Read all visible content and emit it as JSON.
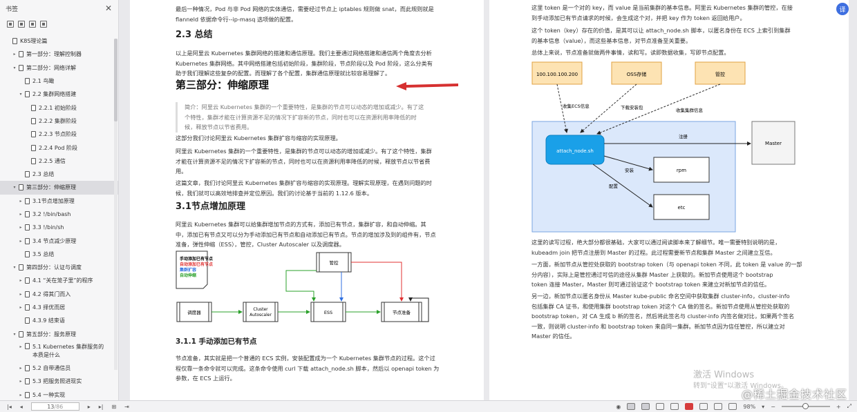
{
  "sidebar": {
    "title": "书签",
    "items": [
      {
        "label": "K8S理论篇",
        "level": 0,
        "arrow": ""
      },
      {
        "label": "第一部分：理解控制器",
        "level": 1,
        "arrow": "▸"
      },
      {
        "label": "第二部分：网络详解",
        "level": 1,
        "arrow": "▾"
      },
      {
        "label": "2.1 鸟瞰",
        "level": 2,
        "arrow": ""
      },
      {
        "label": "2.2 集群网络搭建",
        "level": 2,
        "arrow": "▾"
      },
      {
        "label": "2.2.1 初始阶段",
        "level": 3,
        "arrow": ""
      },
      {
        "label": "2.2.2 集群阶段",
        "level": 3,
        "arrow": ""
      },
      {
        "label": "2.2.3 节点阶段",
        "level": 3,
        "arrow": ""
      },
      {
        "label": "2.2.4 Pod 阶段",
        "level": 3,
        "arrow": ""
      },
      {
        "label": "2.2.5 通信",
        "level": 3,
        "arrow": ""
      },
      {
        "label": "2.3 总结",
        "level": 2,
        "arrow": ""
      },
      {
        "label": "第三部分：伸缩原理",
        "level": 1,
        "arrow": "▾",
        "selected": true
      },
      {
        "label": "3.1节点增加原理",
        "level": 2,
        "arrow": "▸"
      },
      {
        "label": "3.2 !/bin/bash",
        "level": 2,
        "arrow": "▸"
      },
      {
        "label": "3.3 !/bin/sh",
        "level": 2,
        "arrow": "▸"
      },
      {
        "label": "3.4 节点减少原理",
        "level": 2,
        "arrow": "▸"
      },
      {
        "label": "3.5 总结",
        "level": 2,
        "arrow": ""
      },
      {
        "label": "第四部分：认证与调度",
        "level": 1,
        "arrow": "▾"
      },
      {
        "label": "4.1 “关在笼子里”的程序",
        "level": 2,
        "arrow": "▸"
      },
      {
        "label": "4.2 得其门而入",
        "level": 2,
        "arrow": "▸"
      },
      {
        "label": "4.3 择优而居",
        "level": 2,
        "arrow": "▸"
      },
      {
        "label": "4.3.9 结束语",
        "level": 2,
        "arrow": ""
      },
      {
        "label": "第五部分：服务原理",
        "level": 1,
        "arrow": "▾"
      },
      {
        "label": "5.1 Kubernetes 集群服务的本质是什么",
        "level": 2,
        "arrow": "▸",
        "wrap": true
      },
      {
        "label": "5.2 自带通信员",
        "level": 2,
        "arrow": "▸"
      },
      {
        "label": "5.3 把服务照进现实",
        "level": 2,
        "arrow": "▸"
      },
      {
        "label": "5.4 一种实现",
        "level": 2,
        "arrow": "▸"
      }
    ]
  },
  "left_page": {
    "p_top": [
      "最后一种情况，Pod 与非 Pod 网络的实体通信，需要经过节点上 iptables 规则做 snat，而此规则就是",
      "flanneld 依据命令行--ip-masq 选项做的配置。"
    ],
    "h2_summary": "2.3 总结",
    "p_summary": [
      "以上是阿里云 Kubernetes 集群网络的搭建和通信原理。我们主要通过网络搭建和通信两个角度去分析",
      "Kubernetes 集群网络。其中网络搭建包括初始阶段，集群阶段，节点阶段以及 Pod 阶段，这么分类有",
      "助于我们理解这些复杂的配置。而理解了各个配置，集群通信原理就比较容易理解了。"
    ],
    "h1_part3": "第三部分：伸缩原理",
    "quote": [
      "简介：阿里云 Kubernetes 集群的一个重要特性，是集群的节点可以动态的增加或减少。有了这",
      "个特性，集群才能在计算资源不足的情况下扩容新的节点，同时也可以在资源利用率降低的时",
      "候，释放节点以节省费用。"
    ],
    "p_discuss": "这部分我们讨论阿里云 Kubernetes 集群扩容与缩容的实现原理。",
    "p_feature": [
      "阿里云 Kubernetes 集群的一个重要特性，是集群的节点可以动态的增加或减少。有了这个特性，集群",
      "才能在计算资源不足的情况下扩容新的节点，同时也可以在资源利用率降低的时候，释放节点以节省费",
      "用。"
    ],
    "p_article": [
      "这篇文章，我们讨论阿里云 Kubernetes 集群扩容与缩容的实现原理。理解实现原理，在遇到问题的时",
      "候，我们就可以高效地排查并定位原因。我们的讨论基于当前的 1.12.6 版本。"
    ],
    "h2_31": "3.1节点增加原理",
    "p_31": [
      "阿里云 Kubernetes 集群可以给集群增加节点的方式有，添加已有节点，集群扩容，和自动伸缩。其",
      "中，添加已有节点又可以分为手动添加已有节点和自动添加已有节点。节点的增加涉及到的组件有，节点",
      "准备，弹性伸缩（ESS），管控，Cluster Autoscaler 以及调度器。"
    ],
    "diagram1": {
      "legend": [
        "手动添加已有节点",
        "自动添加已有节点",
        "集群扩容",
        "自动伸缩"
      ],
      "legend_colors": [
        "#000000",
        "#e03030",
        "#2f6fe0",
        "#2aa02a"
      ],
      "nodes": {
        "guankong": "管控",
        "scheduler": "调度器",
        "ca1": "Cluster",
        "ca2": "Autoscaler",
        "ess": "ESS",
        "prep": "节点准备"
      }
    },
    "h3_311": "3.1.1 手动添加已有节点",
    "p_311": [
      "节点准备，其实就是把一个普通的 ECS 实例，安装配置成为一个 Kubernetes 集群节点的过程。这个过",
      "程仅靠一条命令就可以完成。这条命令使用 curl 下载 attach_node.sh 脚本，然后以 openapi token 为",
      "参数，在 ECS 上运行。"
    ]
  },
  "right_page": {
    "p1": [
      "这里 token 是一个对的 key，而 value 是当前集群的基本信息。阿里云 Kubernetes 集群的管控，在接",
      "到手动添加已有节点请求的时候，会生成这个对，并把 key 作为 token 返回给用户。"
    ],
    "p2": [
      "这个 token（key）存在的价值，是其可以让 attach_node.sh 脚本，以匿名身份在 ECS 上索引到集群",
      "的基本信息（value），而这些基本信息，对节点准备至关重要。"
    ],
    "p3": "总体上来说，节点准备就做两件事情，读和写。读即数据收集，写即节点配置。",
    "diagram2": {
      "ip": "100.100.100.200",
      "oss": "OSS存储",
      "guankong": "管控",
      "collect_ecs": "收集ECS信息",
      "download": "下载安装包",
      "collect_cluster": "收集集群信息",
      "attach": "attach_node.sh",
      "register": "注册",
      "master": "Master",
      "install": "安装",
      "config": "配置",
      "rpm": "rpm",
      "etc": "etc"
    },
    "p4": [
      "这里的读写过程，绝大部分都很基础，大家可以通过阅读脚本来了解细节。唯一需要特别说明的是，",
      "kubeadm join 把节点注册到 Master 的过程。此过程需要新节点和集群 Master 之间建立互信。"
    ],
    "p5": [
      "一方面，新加节点从管控处获取的 bootstrap token（与 openapi token 不同，此 token 是 value 的一部",
      "分内容），实际上是管控通过可信的途径从集群 Master 上获取的。新加节点使用这个 bootstrap",
      "token 连接 Master，Master 则可通过验证这个 bootstrap token 来建立对新加节点的信任。"
    ],
    "p6": [
      "另一边，新加节点以匿名身份从 Master kube-public 命名空间中获取集群 cluster-info，cluster-info",
      "包括集群 CA 证书，和使用集群 bootstrap token 对这个 CA 做的签名。新加节点使用从管控处获取的",
      "bootstrap token，对 CA 生成 b 新的签名，然后将此签名与 cluster-info 内签名做对比，如果两个签名",
      "一致，则说明 cluster-info 和 bootstrap token 来自同一集群。新加节点因为信任管控，所以建立对",
      "Master 的信任。"
    ]
  },
  "status": {
    "page_current": "13",
    "page_total": "/86",
    "zoom": "98%"
  },
  "overlay": {
    "watermark_line1": "激活 Windows",
    "watermark_line2": "转到\"设置\"以激活 Windows。",
    "brand": "@稀土掘金技术社区",
    "corner_btn": "译"
  }
}
